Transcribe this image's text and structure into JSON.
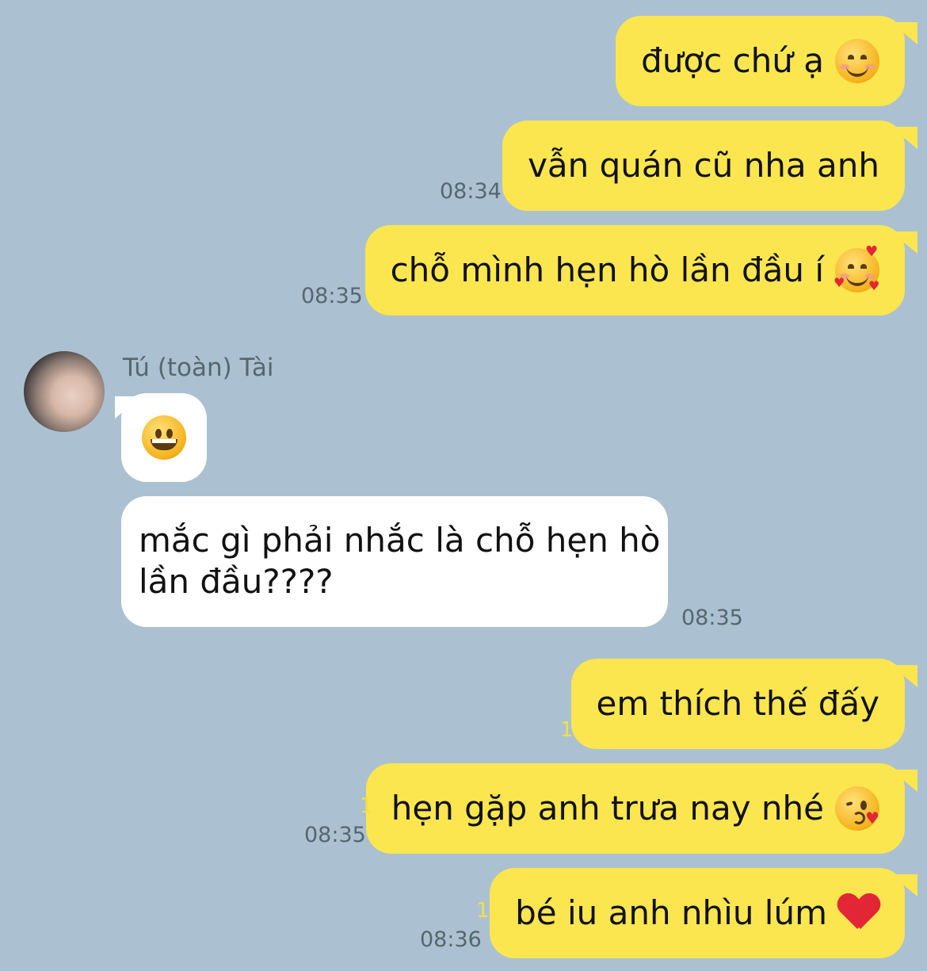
{
  "colors": {
    "background": "#abc1d1",
    "outgoing_bubble": "#fbe64f",
    "incoming_bubble": "#ffffff",
    "time_text": "#56666f",
    "read_count": "#f2df47"
  },
  "messages": [
    {
      "direction": "out",
      "text": "được chứ ạ",
      "emoji": "smiling-face-icon",
      "time": "",
      "read": ""
    },
    {
      "direction": "out",
      "text": "vẫn quán cũ nha anh",
      "emoji": "",
      "time": "08:34",
      "read": ""
    },
    {
      "direction": "out",
      "text": "chỗ mình hẹn hò lần đầu í",
      "emoji": "smiling-face-with-hearts-icon",
      "time": "08:35",
      "read": ""
    },
    {
      "direction": "in",
      "sender": "Tú (toàn) Tài",
      "text": "",
      "emoji": "grinning-face-icon",
      "time": "",
      "read": ""
    },
    {
      "direction": "in",
      "text_line1": "mắc gì phải nhắc là chỗ hẹn hò",
      "text_line2": "lần đầu????",
      "time": "08:35"
    },
    {
      "direction": "out",
      "text": "em thích thế đấy",
      "emoji": "",
      "time": "",
      "read": "1"
    },
    {
      "direction": "out",
      "text": "hẹn gặp anh trưa nay nhé",
      "emoji": "face-blowing-kiss-icon",
      "time": "08:35",
      "read": "1"
    },
    {
      "direction": "out",
      "text": "bé iu anh nhìu lúm",
      "emoji": "red-heart-icon",
      "time": "08:36",
      "read": "1"
    }
  ]
}
